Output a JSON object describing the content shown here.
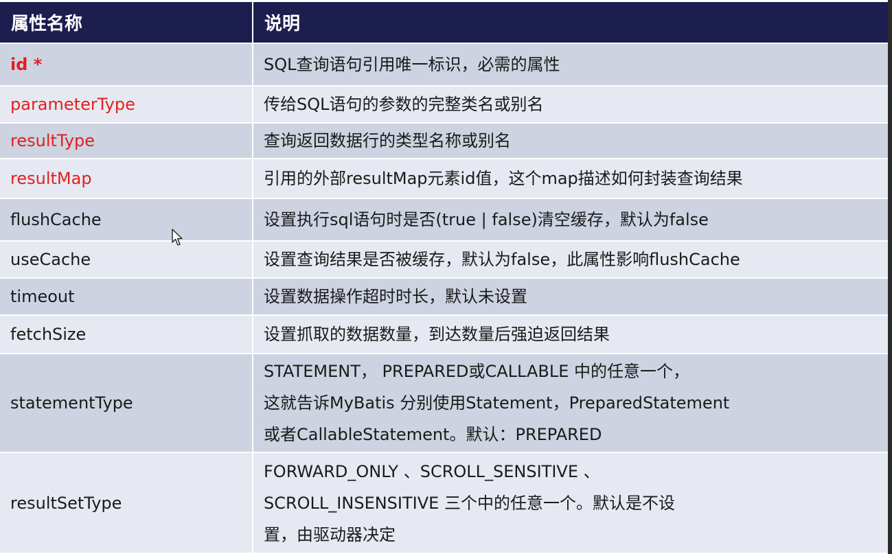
{
  "table": {
    "headers": {
      "name": "属性名称",
      "desc": "说明"
    },
    "rows": [
      {
        "name": "id *",
        "style": "required",
        "shade": "dark",
        "height": 62,
        "desc": [
          "SQL查询语句引用唯一标识，必需的属性"
        ]
      },
      {
        "name": "parameterType",
        "style": "key",
        "shade": "light",
        "height": 54,
        "desc": [
          "传给SQL语句的参数的完整类名或别名"
        ]
      },
      {
        "name": "resultType",
        "style": "key",
        "shade": "dark",
        "height": 52,
        "desc": [
          "查询返回数据行的类型名称或别名"
        ]
      },
      {
        "name": "resultMap",
        "style": "key",
        "shade": "light",
        "height": 58,
        "desc": [
          "引用的外部resultMap元素id值，这个map描述如何封装查询结果"
        ]
      },
      {
        "name": "flushCache",
        "style": "normal",
        "shade": "dark",
        "height": 62,
        "desc": [
          "设置执行sql语句时是否(true | false)清空缓存，默认为false"
        ]
      },
      {
        "name": "useCache",
        "style": "normal",
        "shade": "light",
        "height": 54,
        "desc": [
          "设置查询结果是否被缓存，默认为false，此属性影响flushCache"
        ]
      },
      {
        "name": "timeout",
        "style": "normal",
        "shade": "dark",
        "height": 54,
        "desc": [
          "设置数据操作超时时长，默认未设置"
        ]
      },
      {
        "name": "fetchSize",
        "style": "normal",
        "shade": "light",
        "height": 56,
        "desc": [
          "设置抓取的数据数量，到达数量后强迫返回结果"
        ]
      },
      {
        "name": "statementType",
        "style": "normal",
        "shade": "dark",
        "height": 144,
        "desc": [
          "STATEMENT， PREPARED或CALLABLE 中的任意一个，",
          "这就告诉MyBatis 分别使用Statement，PreparedStatement",
          "或者CallableStatement。默认：PREPARED"
        ]
      },
      {
        "name": "resultSetType",
        "style": "normal",
        "shade": "light",
        "height": 146,
        "desc": [
          "FORWARD_ONLY 、SCROLL_SENSITIVE 、",
          "SCROLL_INSENSITIVE 三个中的任意一个。默认是不设",
          "置，由驱动器决定"
        ]
      }
    ]
  },
  "colors": {
    "header_bg": "#1c1e50",
    "row_dark": "#cdd3e1",
    "row_light": "#e6e9f1",
    "highlight_text": "#e02020"
  },
  "icons": {
    "cursor": "mouse-pointer-icon"
  }
}
